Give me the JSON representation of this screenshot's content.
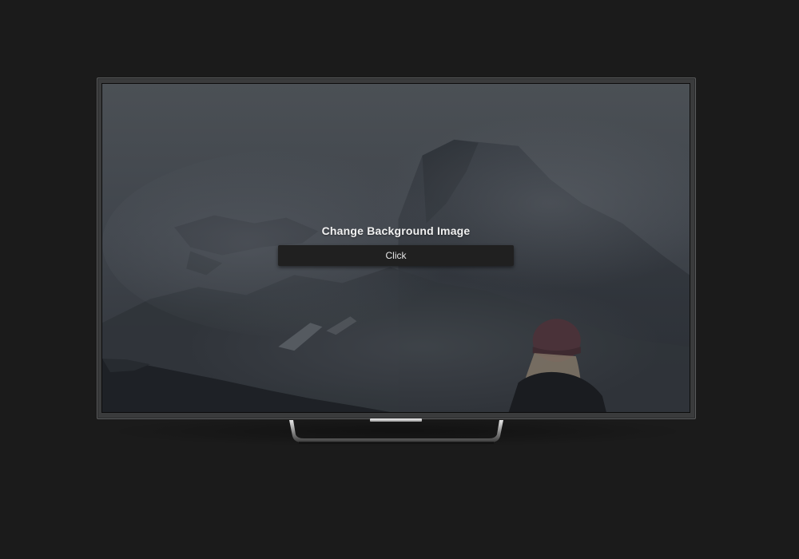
{
  "screen": {
    "title": "Change Background Image",
    "button_label": "Click"
  },
  "colors": {
    "page_background": "#1b1b1b",
    "tv_frame": "#3a3b3c",
    "button_background": "#202020",
    "button_text": "#e6e6e6",
    "title_text": "#f1f1f1"
  }
}
